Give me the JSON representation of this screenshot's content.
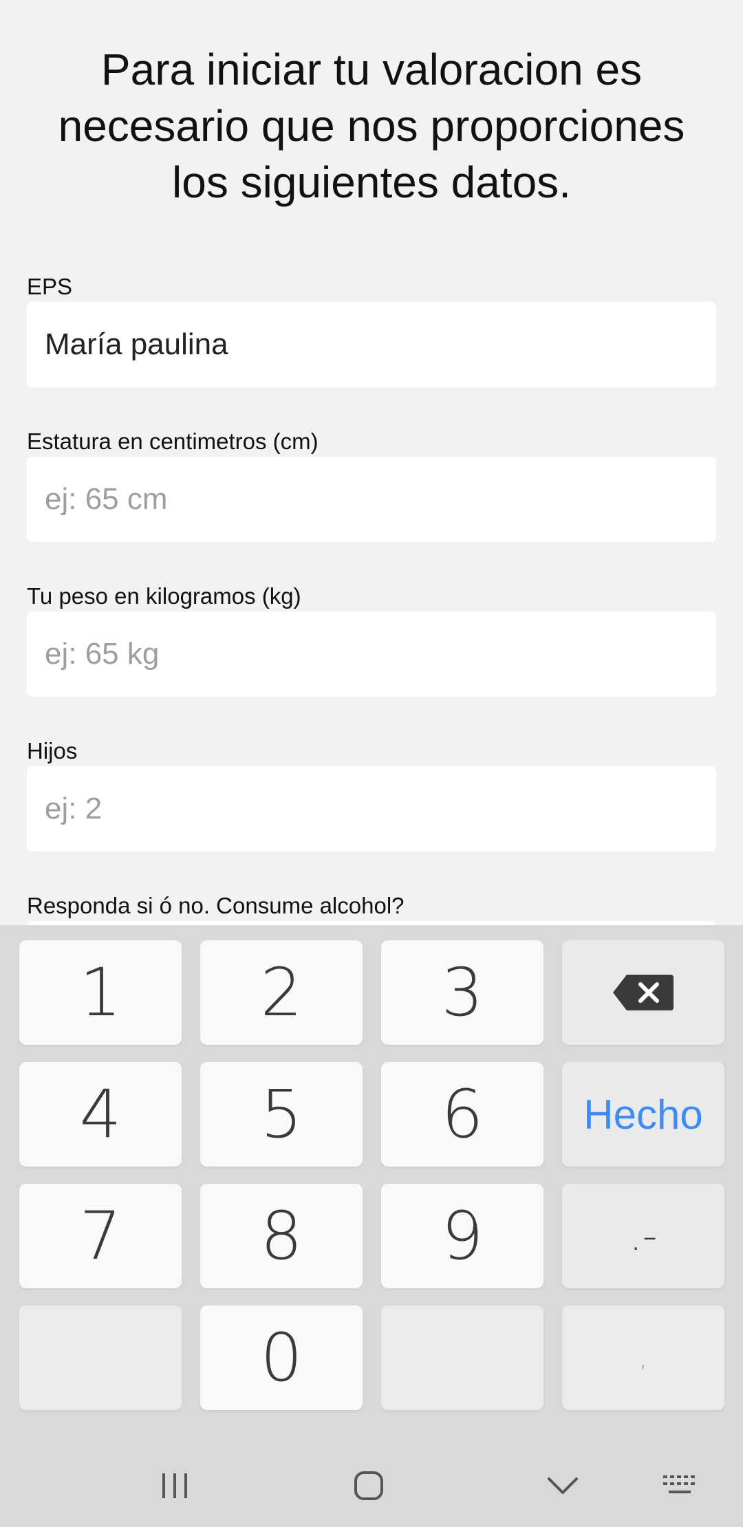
{
  "header": {
    "title": "Para iniciar tu valoracion es necesario que nos proporciones los siguientes datos."
  },
  "form": {
    "eps": {
      "label": "EPS",
      "value": "María paulina"
    },
    "height": {
      "label": "Estatura en centimetros (cm)",
      "placeholder": "ej: 65 cm"
    },
    "weight": {
      "label": "Tu peso en kilogramos (kg)",
      "placeholder": "ej: 65 kg"
    },
    "children": {
      "label": "Hijos",
      "placeholder": "ej: 2"
    },
    "alcohol": {
      "label": "Responda si ó no. Consume alcohol?"
    }
  },
  "keyboard": {
    "keys": {
      "k1": "1",
      "k2": "2",
      "k3": "3",
      "k4": "4",
      "k5": "5",
      "k6": "6",
      "k7": "7",
      "k8": "8",
      "k9": "9",
      "k0": "0",
      "done": "Hecho",
      "dot_dash": ".-",
      "comma": ","
    },
    "accent_color": "#3f8bf0"
  },
  "navbar": {
    "icons": [
      "recent-apps-icon",
      "home-icon",
      "hide-keyboard-icon",
      "keyboard-switch-icon"
    ]
  }
}
